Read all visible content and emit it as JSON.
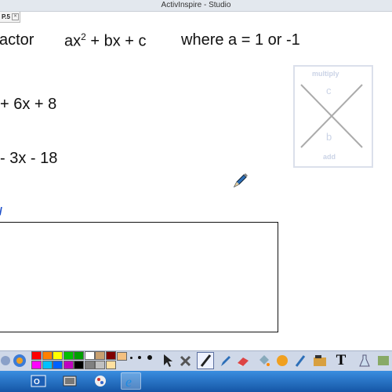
{
  "window": {
    "title": "ActivInspire - Studio"
  },
  "tab": {
    "label": "P.5"
  },
  "lesson": {
    "heading": "actor",
    "expression_base": "ax",
    "expression_exp": "2",
    "expression_rest": "+ bx + c",
    "condition": "where a = 1 or -1",
    "example1": "+ 6x + 8",
    "example2": "- 3x - 18"
  },
  "helper_box": {
    "top_label": "multiply",
    "c_label": "c",
    "b_label": "b",
    "bottom_label": "add"
  },
  "palette": {
    "colors": [
      "#ff0000",
      "#ff8000",
      "#ffff00",
      "#00c000",
      "#00a000",
      "#ffffff",
      "#c8a070",
      "#800000",
      "#ff00ff",
      "#00c0ff",
      "#0060ff",
      "#c000c0",
      "#000000",
      "#808080",
      "#c0c0c0",
      "#ffe0a0"
    ]
  },
  "tools": [
    "select-arrow-icon",
    "tools-icon",
    "pen-icon",
    "highlighter-icon",
    "eraser-icon",
    "fill-icon",
    "color-picker-icon",
    "magic-ink-icon",
    "clipart-icon",
    "text-icon",
    "flask-icon",
    "revealer-icon"
  ],
  "taskbar": {
    "apps": [
      "outlook-icon",
      "file-manager-icon",
      "paint-icon",
      "internet-explorer-icon"
    ]
  }
}
